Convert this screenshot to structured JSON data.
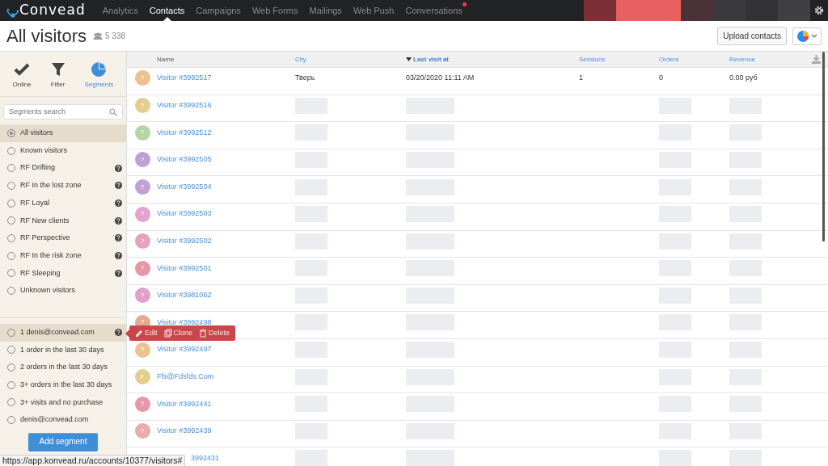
{
  "brand": "Convead",
  "nav": [
    {
      "label": "Analytics",
      "selected": false,
      "notification": false
    },
    {
      "label": "Contacts",
      "selected": true,
      "notification": false
    },
    {
      "label": "Campaigns",
      "selected": false,
      "notification": false
    },
    {
      "label": "Web Forms",
      "selected": false,
      "notification": false
    },
    {
      "label": "Mailings",
      "selected": false,
      "notification": false
    },
    {
      "label": "Web Push",
      "selected": false,
      "notification": false
    },
    {
      "label": "Conversations",
      "selected": false,
      "notification": true
    }
  ],
  "page": {
    "title": "All visitors",
    "count": "5 338",
    "upload_button": "Upload contacts"
  },
  "sidebar": {
    "modes": [
      {
        "kind": "check",
        "label": "Online",
        "selected": false
      },
      {
        "kind": "funnel",
        "label": "Filter",
        "selected": false
      },
      {
        "kind": "pie",
        "label": "Segments",
        "selected": true
      }
    ],
    "search": {
      "placeholder": "Segments search"
    },
    "groups": [
      [
        {
          "label": "All visitors",
          "selected": true,
          "hovered": false,
          "help": false
        },
        {
          "label": "Known visitors",
          "selected": false,
          "hovered": false,
          "help": false
        },
        {
          "label": "RF Drifting",
          "selected": false,
          "hovered": false,
          "help": true
        },
        {
          "label": "RF In the lost zone",
          "selected": false,
          "hovered": false,
          "help": true
        },
        {
          "label": "RF Loyal",
          "selected": false,
          "hovered": false,
          "help": true
        },
        {
          "label": "RF New clients",
          "selected": false,
          "hovered": false,
          "help": true
        },
        {
          "label": "RF Perspective",
          "selected": false,
          "hovered": false,
          "help": true
        },
        {
          "label": "RF In the risk zone",
          "selected": false,
          "hovered": false,
          "help": true
        },
        {
          "label": "RF Sleeping",
          "selected": false,
          "hovered": false,
          "help": true
        },
        {
          "label": "Unknown visitors",
          "selected": false,
          "hovered": false,
          "help": false
        }
      ],
      [
        {
          "label": "1 denis@convead.com",
          "selected": false,
          "hovered": true,
          "help": true
        },
        {
          "label": "1 order in the last 30 days",
          "selected": false,
          "hovered": false,
          "help": false
        },
        {
          "label": "2 orders in the last 30 days",
          "selected": false,
          "hovered": false,
          "help": false
        },
        {
          "label": "3+ orders in the last 30 days",
          "selected": false,
          "hovered": false,
          "help": false
        },
        {
          "label": "3+ visits and no purchase",
          "selected": false,
          "hovered": false,
          "help": false
        },
        {
          "label": "denis@convead.com",
          "selected": false,
          "hovered": false,
          "help": false
        }
      ]
    ],
    "add_button": "Add segment",
    "popup": [
      "Edit",
      "Clone",
      "Delete"
    ]
  },
  "table": {
    "columns": [
      {
        "label": "Name",
        "sorted": false
      },
      {
        "label": "City",
        "sorted": false
      },
      {
        "label": "Last visit at",
        "sorted": true
      },
      {
        "label": "Sessions",
        "sorted": false
      },
      {
        "label": "Orders",
        "sorted": false
      },
      {
        "label": "Revenue",
        "sorted": false
      }
    ],
    "rows": [
      {
        "avatar": "?",
        "color": "#e9c28f",
        "name": "Visitor #3992517",
        "city": "Тверь",
        "last_visit": "03/20/2020 11:11 AM",
        "sessions": "1",
        "orders": "0",
        "revenue": "0.00 руб"
      },
      {
        "avatar": "?",
        "color": "#e3cf8d",
        "name": "Visitor #3992516"
      },
      {
        "avatar": "?",
        "color": "#b7d4a8",
        "name": "Visitor #3992512"
      },
      {
        "avatar": "?",
        "color": "#c0a0d0",
        "name": "Visitor #3992505"
      },
      {
        "avatar": "?",
        "color": "#c3a0d2",
        "name": "Visitor #3992504"
      },
      {
        "avatar": "?",
        "color": "#e3a2cf",
        "name": "Visitor #3992503"
      },
      {
        "avatar": "?",
        "color": "#e6a0c0",
        "name": "Visitor #3992502"
      },
      {
        "avatar": "?",
        "color": "#e597a6",
        "name": "Visitor #3992501"
      },
      {
        "avatar": "?",
        "color": "#e3a0c8",
        "name": "Visitor #3981062"
      },
      {
        "avatar": "?",
        "color": "#e5a890",
        "name": "Visitor #3992498"
      },
      {
        "avatar": "?",
        "color": "#e9c490",
        "name": "Visitor #3992497"
      },
      {
        "avatar": "F",
        "color": "#e3cf8c",
        "name": "Ffs@Fdsfds.Com"
      },
      {
        "avatar": "?",
        "color": "#e599a8",
        "name": "Visitor #3992441"
      },
      {
        "avatar": "?",
        "color": "#e9aca7",
        "name": "Visitor #3992439"
      },
      {
        "name": "3992431",
        "covered": true
      }
    ]
  },
  "status_url": "https://app.konvead.ru/accounts/10377/visitors#"
}
